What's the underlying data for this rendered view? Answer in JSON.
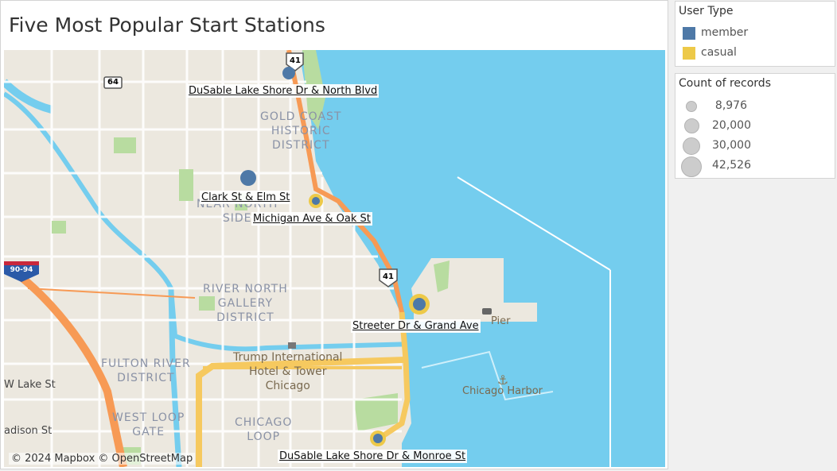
{
  "title": "Five Most Popular Start Stations",
  "legend_color": {
    "title": "User Type",
    "items": [
      {
        "label": "member",
        "color": "#4e79a7"
      },
      {
        "label": "casual",
        "color": "#edc948"
      }
    ]
  },
  "legend_size": {
    "title": "Count of records",
    "items": [
      "8,976",
      "20,000",
      "30,000",
      "42,526"
    ]
  },
  "stations": [
    {
      "name": "DuSable Lake Shore Dr & North Blvd",
      "member": true,
      "casual": false
    },
    {
      "name": "Clark St & Elm St",
      "member": true,
      "casual": false
    },
    {
      "name": "Michigan Ave & Oak St",
      "member": true,
      "casual": true
    },
    {
      "name": "Streeter Dr & Grand Ave",
      "member": true,
      "casual": true
    },
    {
      "name": "DuSable Lake Shore Dr & Monroe St",
      "member": true,
      "casual": true
    }
  ],
  "map_labels": {
    "gold_coast": "GOLD COAST\nHISTORIC\nDISTRICT",
    "near_north": "NEAR NORTH\nSIDE",
    "river_north": "RIVER NORTH\nGALLERY\nDISTRICT",
    "fulton_river": "FULTON RIVER\nDISTRICT",
    "west_loop": "WEST LOOP\nGATE",
    "chicago_loop": "CHICAGO\nLOOP",
    "trump": "Trump International\nHotel & Tower\nChicago",
    "chicago_harbor": "Chicago Harbor",
    "pier": "Pier",
    "w_lake_st": "W Lake St",
    "madison_st": "adison St",
    "shield_41a": "41",
    "shield_41b": "41",
    "shield_64": "64",
    "shield_9094": "90-94"
  },
  "attribution": "© 2024 Mapbox  © OpenStreetMap",
  "colors": {
    "water": "#74cdee",
    "land": "#ece8df",
    "highway": "#f6c95f",
    "interstate": "#f79a55",
    "park": "#b8dca0"
  }
}
